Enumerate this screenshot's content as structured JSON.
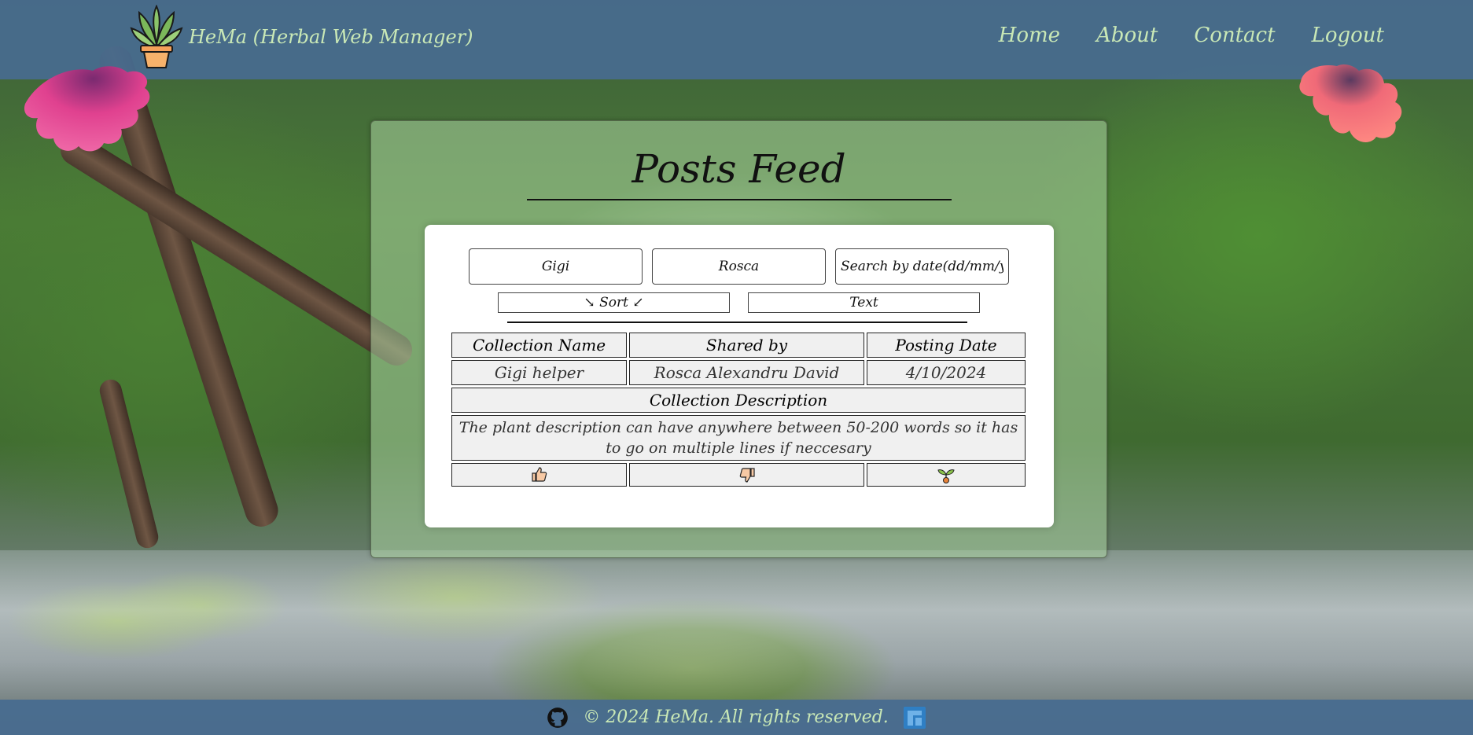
{
  "header": {
    "brand": "HeMa (Herbal Web Manager)",
    "nav": [
      "Home",
      "About",
      "Contact",
      "Logout"
    ]
  },
  "main": {
    "title": "Posts Feed",
    "filters": {
      "first_name_value": "Gigi",
      "last_name_value": "Rosca",
      "date_placeholder": "Search by date(dd/mm/yyyy)"
    },
    "sort_label": "↘ Sort ↙",
    "text_label": "Text",
    "table": {
      "headers": [
        "Collection Name",
        "Shared by",
        "Posting Date"
      ],
      "row": [
        "Gigi helper",
        "Rosca Alexandru David",
        "4/10/2024"
      ],
      "description_header": "Collection Description",
      "description": "The plant description can have anywhere between 50-200 words so it has to go on multiple lines if neccesary",
      "actions": [
        "thumbs-up-icon",
        "thumbs-down-icon",
        "sprout-icon"
      ]
    }
  },
  "footer": {
    "text": "© 2024 HeMa. All rights reserved.",
    "icons": [
      "github-icon",
      "app-logo-icon"
    ]
  },
  "colors": {
    "header_bg": "#486c8f",
    "header_text": "#c9e8b6",
    "panel_bg": "#aad2a0"
  }
}
